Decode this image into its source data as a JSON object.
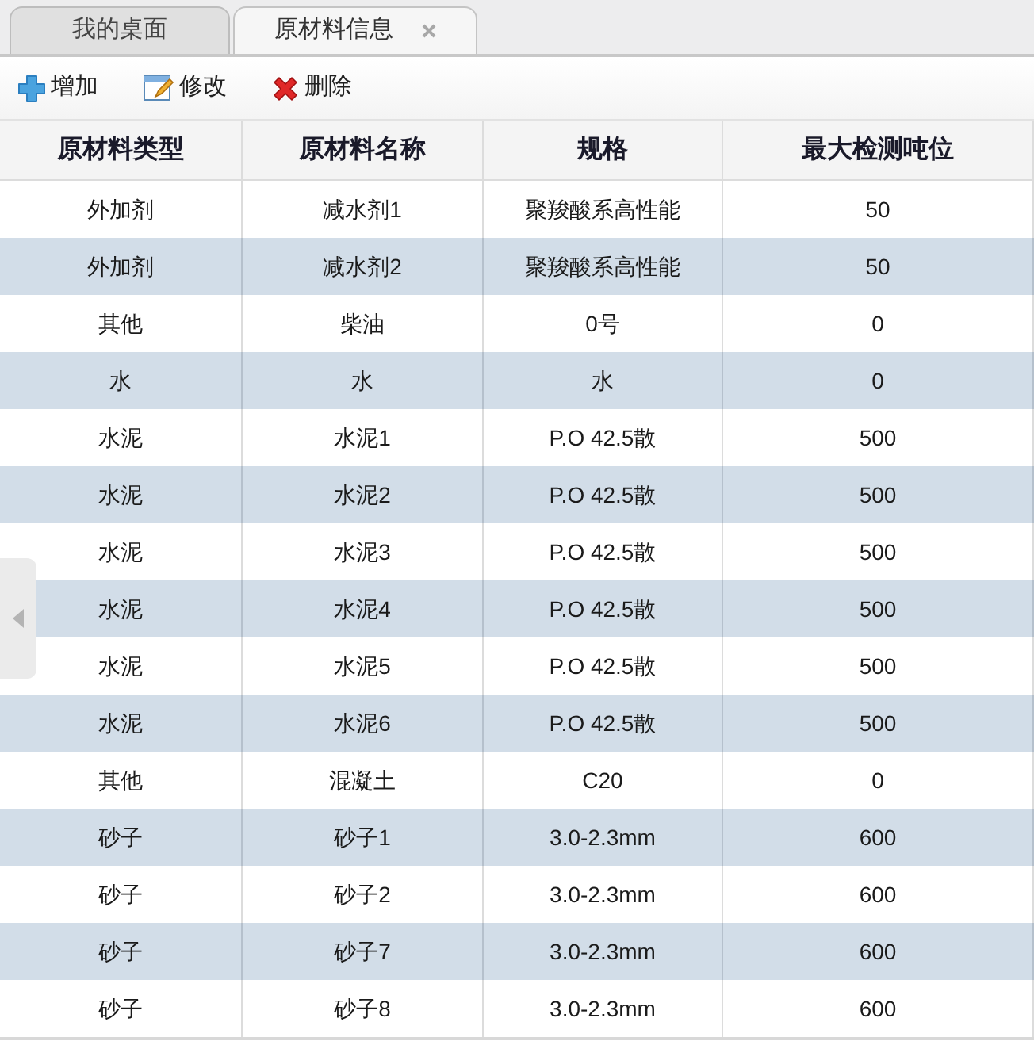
{
  "tabs": [
    {
      "label": "我的桌面",
      "selected": false,
      "closable": false
    },
    {
      "label": "原材料信息",
      "selected": true,
      "closable": true
    }
  ],
  "toolbar": [
    {
      "kind": "add",
      "label": "增加"
    },
    {
      "kind": "edit",
      "label": "修改"
    },
    {
      "kind": "delete",
      "label": "删除"
    }
  ],
  "table": {
    "columns": [
      "原材料类型",
      "原材料名称",
      "规格",
      "最大检测吨位"
    ],
    "rows": [
      [
        "外加剂",
        "减水剂1",
        "聚羧酸系高性能",
        "50"
      ],
      [
        "外加剂",
        "减水剂2",
        "聚羧酸系高性能",
        "50"
      ],
      [
        "其他",
        "柴油",
        "0号",
        "0"
      ],
      [
        "水",
        "水",
        "水",
        "0"
      ],
      [
        "水泥",
        "水泥1",
        "P.O 42.5散",
        "500"
      ],
      [
        "水泥",
        "水泥2",
        "P.O 42.5散",
        "500"
      ],
      [
        "水泥",
        "水泥3",
        "P.O 42.5散",
        "500"
      ],
      [
        "水泥",
        "水泥4",
        "P.O 42.5散",
        "500"
      ],
      [
        "水泥",
        "水泥5",
        "P.O 42.5散",
        "500"
      ],
      [
        "水泥",
        "水泥6",
        "P.O 42.5散",
        "500"
      ],
      [
        "其他",
        "混凝土",
        "C20",
        "0"
      ],
      [
        "砂子",
        "砂子1",
        "3.0-2.3mm",
        "600"
      ],
      [
        "砂子",
        "砂子2",
        "3.0-2.3mm",
        "600"
      ],
      [
        "砂子",
        "砂子7",
        "3.0-2.3mm",
        "600"
      ],
      [
        "砂子",
        "砂子8",
        "3.0-2.3mm",
        "600"
      ]
    ]
  }
}
